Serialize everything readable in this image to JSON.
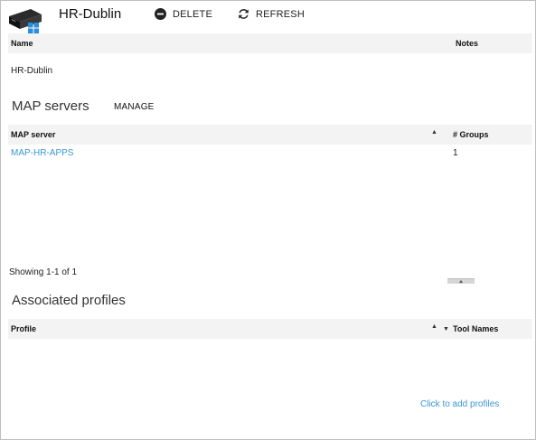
{
  "header": {
    "title": "HR-Dublin",
    "delete_label": "DELETE",
    "refresh_label": "REFRESH"
  },
  "details_table": {
    "columns": [
      "Name",
      "Notes"
    ],
    "row": {
      "name": "HR-Dublin",
      "notes": ""
    }
  },
  "map_servers": {
    "heading": "MAP servers",
    "manage_label": "MANAGE",
    "columns": [
      "MAP server",
      "# Groups"
    ],
    "rows": [
      {
        "server": "MAP-HR-APPS",
        "groups": "1"
      }
    ],
    "pagination": "Showing 1-1 of 1"
  },
  "associated_profiles": {
    "heading": "Associated profiles",
    "columns": [
      "Profile",
      "Tool Names"
    ],
    "add_link": "Click to add profiles"
  },
  "colors": {
    "link": "#3a97d4",
    "header_bg": "#f3f3f3",
    "border": "#bfbfbf"
  },
  "icons": [
    "server-windows-icon",
    "minus-circle-icon",
    "refresh-icon",
    "sort-asc-icon",
    "sort-desc-icon"
  ]
}
